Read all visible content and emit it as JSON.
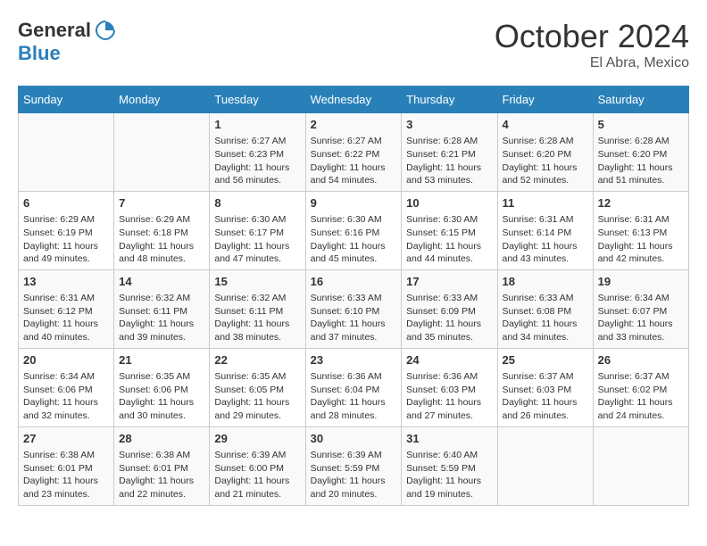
{
  "header": {
    "logo_general": "General",
    "logo_blue": "Blue",
    "month": "October 2024",
    "location": "El Abra, Mexico"
  },
  "weekdays": [
    "Sunday",
    "Monday",
    "Tuesday",
    "Wednesday",
    "Thursday",
    "Friday",
    "Saturday"
  ],
  "weeks": [
    [
      {
        "day": "",
        "info": ""
      },
      {
        "day": "",
        "info": ""
      },
      {
        "day": "1",
        "sunrise": "6:27 AM",
        "sunset": "6:23 PM",
        "daylight": "11 hours and 56 minutes."
      },
      {
        "day": "2",
        "sunrise": "6:27 AM",
        "sunset": "6:22 PM",
        "daylight": "11 hours and 54 minutes."
      },
      {
        "day": "3",
        "sunrise": "6:28 AM",
        "sunset": "6:21 PM",
        "daylight": "11 hours and 53 minutes."
      },
      {
        "day": "4",
        "sunrise": "6:28 AM",
        "sunset": "6:20 PM",
        "daylight": "11 hours and 52 minutes."
      },
      {
        "day": "5",
        "sunrise": "6:28 AM",
        "sunset": "6:20 PM",
        "daylight": "11 hours and 51 minutes."
      }
    ],
    [
      {
        "day": "6",
        "sunrise": "6:29 AM",
        "sunset": "6:19 PM",
        "daylight": "11 hours and 49 minutes."
      },
      {
        "day": "7",
        "sunrise": "6:29 AM",
        "sunset": "6:18 PM",
        "daylight": "11 hours and 48 minutes."
      },
      {
        "day": "8",
        "sunrise": "6:30 AM",
        "sunset": "6:17 PM",
        "daylight": "11 hours and 47 minutes."
      },
      {
        "day": "9",
        "sunrise": "6:30 AM",
        "sunset": "6:16 PM",
        "daylight": "11 hours and 45 minutes."
      },
      {
        "day": "10",
        "sunrise": "6:30 AM",
        "sunset": "6:15 PM",
        "daylight": "11 hours and 44 minutes."
      },
      {
        "day": "11",
        "sunrise": "6:31 AM",
        "sunset": "6:14 PM",
        "daylight": "11 hours and 43 minutes."
      },
      {
        "day": "12",
        "sunrise": "6:31 AM",
        "sunset": "6:13 PM",
        "daylight": "11 hours and 42 minutes."
      }
    ],
    [
      {
        "day": "13",
        "sunrise": "6:31 AM",
        "sunset": "6:12 PM",
        "daylight": "11 hours and 40 minutes."
      },
      {
        "day": "14",
        "sunrise": "6:32 AM",
        "sunset": "6:11 PM",
        "daylight": "11 hours and 39 minutes."
      },
      {
        "day": "15",
        "sunrise": "6:32 AM",
        "sunset": "6:11 PM",
        "daylight": "11 hours and 38 minutes."
      },
      {
        "day": "16",
        "sunrise": "6:33 AM",
        "sunset": "6:10 PM",
        "daylight": "11 hours and 37 minutes."
      },
      {
        "day": "17",
        "sunrise": "6:33 AM",
        "sunset": "6:09 PM",
        "daylight": "11 hours and 35 minutes."
      },
      {
        "day": "18",
        "sunrise": "6:33 AM",
        "sunset": "6:08 PM",
        "daylight": "11 hours and 34 minutes."
      },
      {
        "day": "19",
        "sunrise": "6:34 AM",
        "sunset": "6:07 PM",
        "daylight": "11 hours and 33 minutes."
      }
    ],
    [
      {
        "day": "20",
        "sunrise": "6:34 AM",
        "sunset": "6:06 PM",
        "daylight": "11 hours and 32 minutes."
      },
      {
        "day": "21",
        "sunrise": "6:35 AM",
        "sunset": "6:06 PM",
        "daylight": "11 hours and 30 minutes."
      },
      {
        "day": "22",
        "sunrise": "6:35 AM",
        "sunset": "6:05 PM",
        "daylight": "11 hours and 29 minutes."
      },
      {
        "day": "23",
        "sunrise": "6:36 AM",
        "sunset": "6:04 PM",
        "daylight": "11 hours and 28 minutes."
      },
      {
        "day": "24",
        "sunrise": "6:36 AM",
        "sunset": "6:03 PM",
        "daylight": "11 hours and 27 minutes."
      },
      {
        "day": "25",
        "sunrise": "6:37 AM",
        "sunset": "6:03 PM",
        "daylight": "11 hours and 26 minutes."
      },
      {
        "day": "26",
        "sunrise": "6:37 AM",
        "sunset": "6:02 PM",
        "daylight": "11 hours and 24 minutes."
      }
    ],
    [
      {
        "day": "27",
        "sunrise": "6:38 AM",
        "sunset": "6:01 PM",
        "daylight": "11 hours and 23 minutes."
      },
      {
        "day": "28",
        "sunrise": "6:38 AM",
        "sunset": "6:01 PM",
        "daylight": "11 hours and 22 minutes."
      },
      {
        "day": "29",
        "sunrise": "6:39 AM",
        "sunset": "6:00 PM",
        "daylight": "11 hours and 21 minutes."
      },
      {
        "day": "30",
        "sunrise": "6:39 AM",
        "sunset": "5:59 PM",
        "daylight": "11 hours and 20 minutes."
      },
      {
        "day": "31",
        "sunrise": "6:40 AM",
        "sunset": "5:59 PM",
        "daylight": "11 hours and 19 minutes."
      },
      {
        "day": "",
        "info": ""
      },
      {
        "day": "",
        "info": ""
      }
    ]
  ],
  "labels": {
    "sunrise": "Sunrise:",
    "sunset": "Sunset:",
    "daylight": "Daylight:"
  }
}
